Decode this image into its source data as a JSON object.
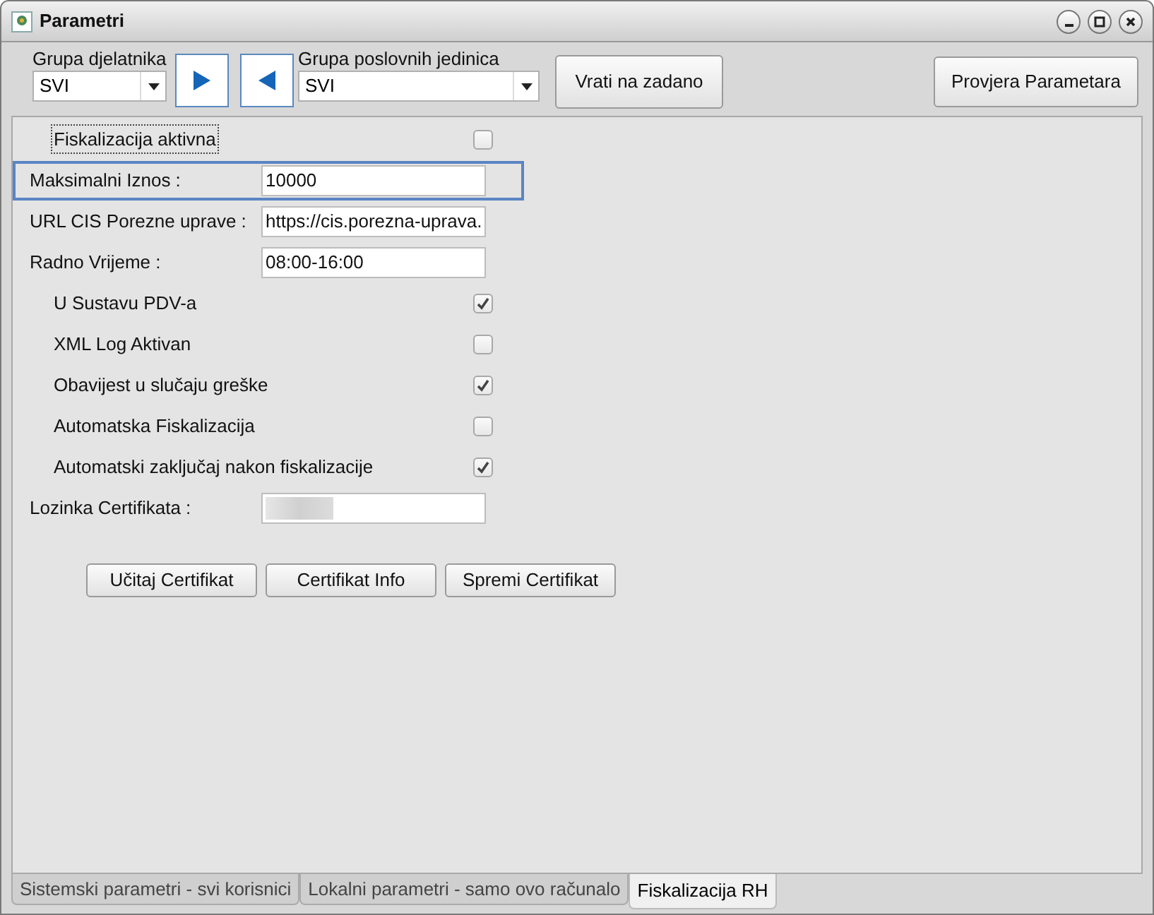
{
  "window": {
    "title": "Parametri"
  },
  "toolbar": {
    "employee_group": {
      "label": "Grupa djelatnika",
      "value": "SVI"
    },
    "arrows": [
      {
        "kind": "right"
      },
      {
        "kind": "left"
      }
    ],
    "unit_group": {
      "label": "Grupa poslovnih jedinica",
      "value": "SVI"
    },
    "buttons": [
      "Vrati na zadano",
      "Provjera Parametara"
    ]
  },
  "rows": [
    {
      "kind": "checkbox",
      "label": "Fiskalizacija aktivna",
      "checked": false,
      "focused": true
    },
    {
      "kind": "field",
      "label": "Maksimalni Iznos :",
      "value": "10000",
      "highlighted": true
    },
    {
      "kind": "field",
      "label": "URL CIS Porezne uprave :",
      "value": "https://cis.porezna-uprava.",
      "highlighted": false
    },
    {
      "kind": "field",
      "label": "Radno Vrijeme :",
      "value": "08:00-16:00",
      "highlighted": false
    },
    {
      "kind": "checkbox",
      "label": "U Sustavu PDV-a",
      "checked": true,
      "focused": false
    },
    {
      "kind": "checkbox",
      "label": "XML Log Aktivan",
      "checked": false,
      "focused": false
    },
    {
      "kind": "checkbox",
      "label": "Obavijest u slučaju greške",
      "checked": true,
      "focused": false
    },
    {
      "kind": "checkbox",
      "label": "Automatska Fiskalizacija",
      "checked": false,
      "focused": false
    },
    {
      "kind": "checkbox",
      "label": "Automatski zaključaj nakon fiskalizacije",
      "checked": true,
      "focused": false
    },
    {
      "kind": "password",
      "label": "Lozinka Certifikata :",
      "highlighted": false
    }
  ],
  "cert_buttons": [
    "Učitaj Certifikat",
    "Certifikat Info",
    "Spremi Certifikat"
  ],
  "tabs": [
    {
      "label": "Sistemski parametri - svi korisnici",
      "selected": false
    },
    {
      "label": "Lokalni parametri - samo ovo računalo",
      "selected": false
    },
    {
      "label": "Fiskalizacija RH",
      "selected": true
    }
  ]
}
